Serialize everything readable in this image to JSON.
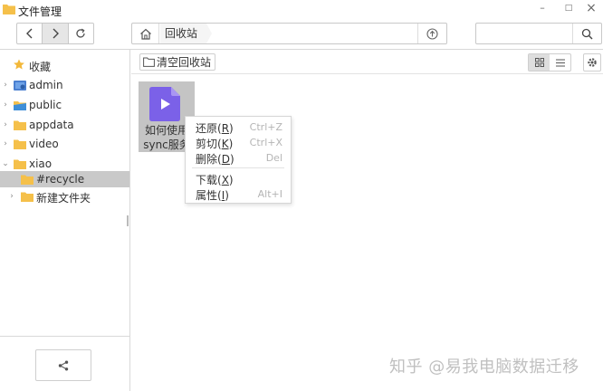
{
  "window": {
    "title": "文件管理",
    "minimize": "–",
    "maximize": "□",
    "close": "×"
  },
  "toolbar": {
    "back_icon": "chevron-left-icon",
    "forward_icon": "chevron-right-icon",
    "refresh_icon": "refresh-icon",
    "breadcrumb": [
      "回收站"
    ],
    "search_placeholder": ""
  },
  "sidebar": {
    "items": [
      {
        "label": "收藏",
        "icon": "star-icon"
      },
      {
        "label": "admin",
        "icon": "user-folder-icon"
      },
      {
        "label": "public",
        "icon": "shared-folder-icon"
      },
      {
        "label": "appdata",
        "icon": "folder-icon"
      },
      {
        "label": "video",
        "icon": "folder-icon"
      },
      {
        "label": "xiao",
        "icon": "folder-icon"
      },
      {
        "label": "#recycle",
        "icon": "folder-icon"
      },
      {
        "label": "新建文件夹",
        "icon": "folder-icon"
      }
    ]
  },
  "main": {
    "empty_recycle_label": "清空回收站",
    "file": {
      "name_line1": "如何使用",
      "name_line2": "sync服务"
    }
  },
  "context_menu": {
    "items": [
      {
        "label": "还原(",
        "key": "R",
        "close": ")",
        "shortcut": "Ctrl+Z"
      },
      {
        "label": "剪切(",
        "key": "K",
        "close": ")",
        "shortcut": "Ctrl+X"
      },
      {
        "label": "删除(",
        "key": "D",
        "close": ")",
        "shortcut": "Del"
      },
      {
        "label": "下载(",
        "key": "X",
        "close": ")",
        "shortcut": ""
      },
      {
        "label": "属性(",
        "key": "I",
        "close": ")",
        "shortcut": "Alt+I"
      }
    ]
  },
  "watermark": "知乎 @易我电脑数据迁移",
  "colors": {
    "folder": "#f5c04a",
    "file_icon": "#7b61e8",
    "selected": "#c9c9c9"
  }
}
